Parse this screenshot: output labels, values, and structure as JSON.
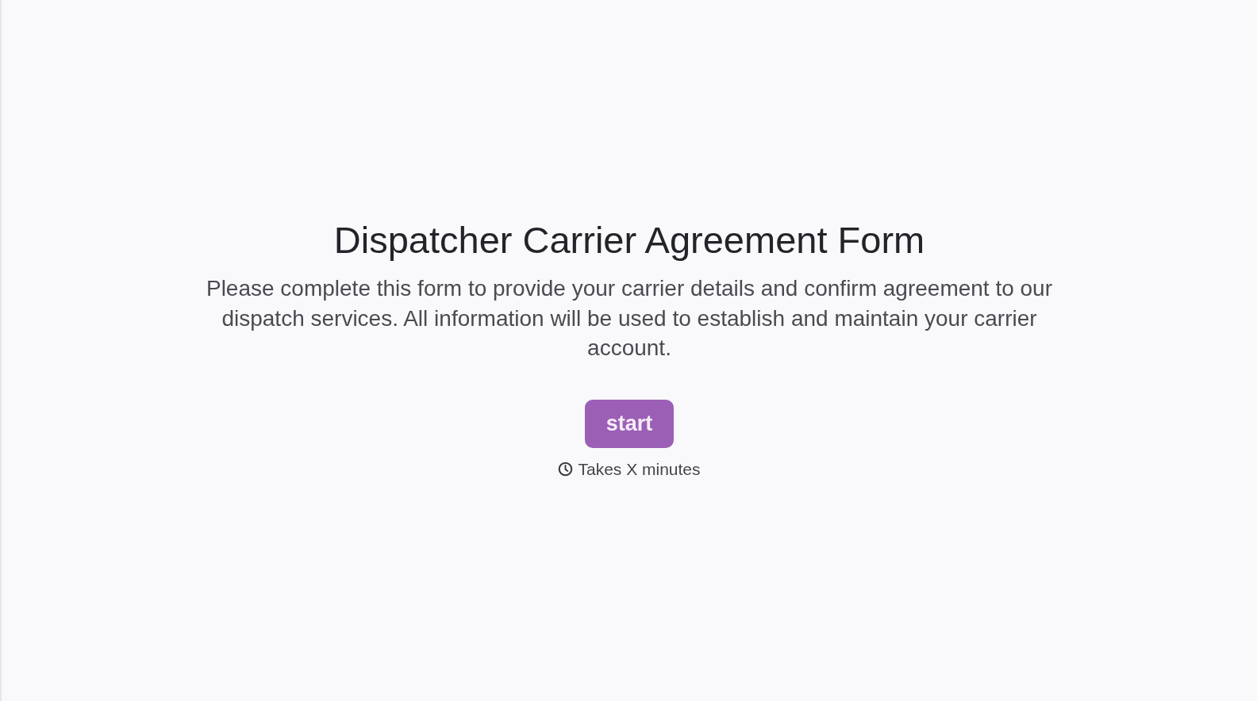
{
  "title": "Dispatcher Carrier Agreement Form",
  "description": "Please complete this form to provide your carrier details and confirm agreement to our dispatch services. All information will be used to establish and maintain your carrier account.",
  "start_button": {
    "label": "start"
  },
  "duration": {
    "text": "Takes X minutes"
  }
}
